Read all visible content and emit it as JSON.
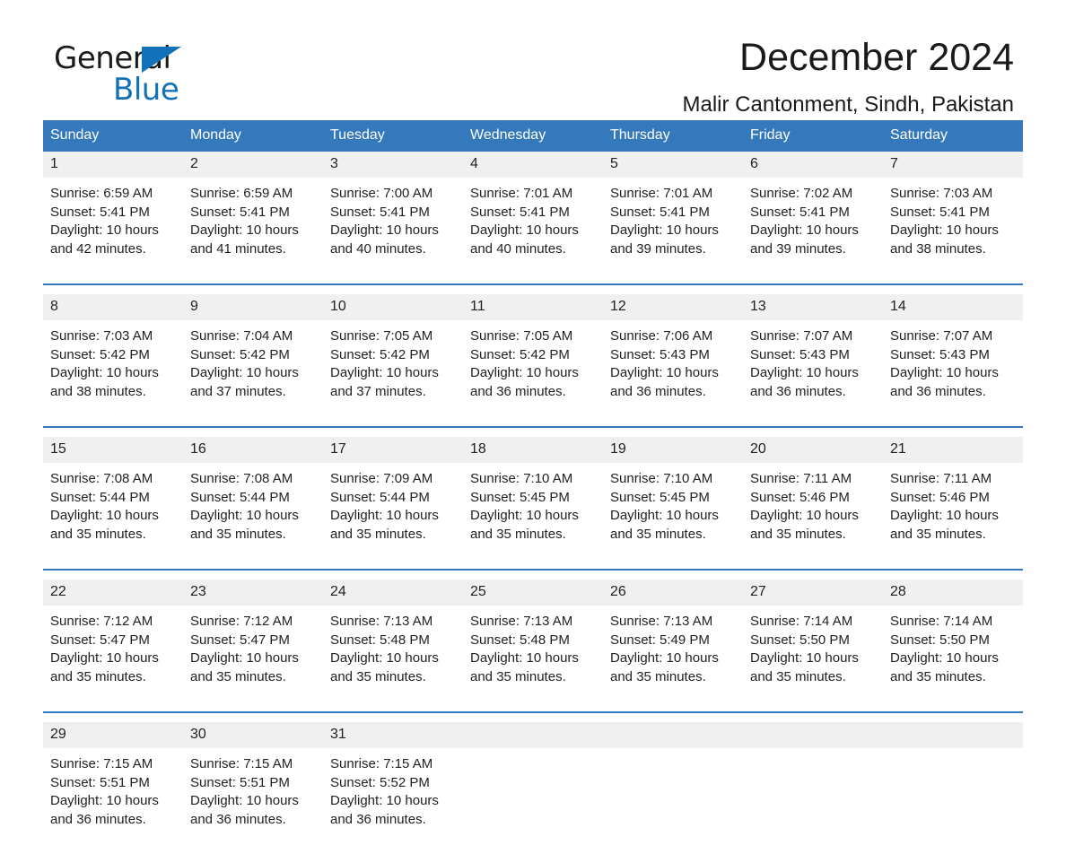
{
  "logo": {
    "word1": "General",
    "word2": "Blue",
    "triangle_color": "#1272b9"
  },
  "header": {
    "title": "December 2024",
    "subtitle": "Malir Cantonment, Sindh, Pakistan",
    "accent_color": "#3479bc",
    "daynum_bg": "#f0f0f0"
  },
  "calendar": {
    "weekday_headers": [
      "Sunday",
      "Monday",
      "Tuesday",
      "Wednesday",
      "Thursday",
      "Friday",
      "Saturday"
    ],
    "weeks": [
      [
        {
          "day": "1",
          "sunrise": "Sunrise: 6:59 AM",
          "sunset": "Sunset: 5:41 PM",
          "daylight1": "Daylight: 10 hours",
          "daylight2": "and 42 minutes."
        },
        {
          "day": "2",
          "sunrise": "Sunrise: 6:59 AM",
          "sunset": "Sunset: 5:41 PM",
          "daylight1": "Daylight: 10 hours",
          "daylight2": "and 41 minutes."
        },
        {
          "day": "3",
          "sunrise": "Sunrise: 7:00 AM",
          "sunset": "Sunset: 5:41 PM",
          "daylight1": "Daylight: 10 hours",
          "daylight2": "and 40 minutes."
        },
        {
          "day": "4",
          "sunrise": "Sunrise: 7:01 AM",
          "sunset": "Sunset: 5:41 PM",
          "daylight1": "Daylight: 10 hours",
          "daylight2": "and 40 minutes."
        },
        {
          "day": "5",
          "sunrise": "Sunrise: 7:01 AM",
          "sunset": "Sunset: 5:41 PM",
          "daylight1": "Daylight: 10 hours",
          "daylight2": "and 39 minutes."
        },
        {
          "day": "6",
          "sunrise": "Sunrise: 7:02 AM",
          "sunset": "Sunset: 5:41 PM",
          "daylight1": "Daylight: 10 hours",
          "daylight2": "and 39 minutes."
        },
        {
          "day": "7",
          "sunrise": "Sunrise: 7:03 AM",
          "sunset": "Sunset: 5:41 PM",
          "daylight1": "Daylight: 10 hours",
          "daylight2": "and 38 minutes."
        }
      ],
      [
        {
          "day": "8",
          "sunrise": "Sunrise: 7:03 AM",
          "sunset": "Sunset: 5:42 PM",
          "daylight1": "Daylight: 10 hours",
          "daylight2": "and 38 minutes."
        },
        {
          "day": "9",
          "sunrise": "Sunrise: 7:04 AM",
          "sunset": "Sunset: 5:42 PM",
          "daylight1": "Daylight: 10 hours",
          "daylight2": "and 37 minutes."
        },
        {
          "day": "10",
          "sunrise": "Sunrise: 7:05 AM",
          "sunset": "Sunset: 5:42 PM",
          "daylight1": "Daylight: 10 hours",
          "daylight2": "and 37 minutes."
        },
        {
          "day": "11",
          "sunrise": "Sunrise: 7:05 AM",
          "sunset": "Sunset: 5:42 PM",
          "daylight1": "Daylight: 10 hours",
          "daylight2": "and 36 minutes."
        },
        {
          "day": "12",
          "sunrise": "Sunrise: 7:06 AM",
          "sunset": "Sunset: 5:43 PM",
          "daylight1": "Daylight: 10 hours",
          "daylight2": "and 36 minutes."
        },
        {
          "day": "13",
          "sunrise": "Sunrise: 7:07 AM",
          "sunset": "Sunset: 5:43 PM",
          "daylight1": "Daylight: 10 hours",
          "daylight2": "and 36 minutes."
        },
        {
          "day": "14",
          "sunrise": "Sunrise: 7:07 AM",
          "sunset": "Sunset: 5:43 PM",
          "daylight1": "Daylight: 10 hours",
          "daylight2": "and 36 minutes."
        }
      ],
      [
        {
          "day": "15",
          "sunrise": "Sunrise: 7:08 AM",
          "sunset": "Sunset: 5:44 PM",
          "daylight1": "Daylight: 10 hours",
          "daylight2": "and 35 minutes."
        },
        {
          "day": "16",
          "sunrise": "Sunrise: 7:08 AM",
          "sunset": "Sunset: 5:44 PM",
          "daylight1": "Daylight: 10 hours",
          "daylight2": "and 35 minutes."
        },
        {
          "day": "17",
          "sunrise": "Sunrise: 7:09 AM",
          "sunset": "Sunset: 5:44 PM",
          "daylight1": "Daylight: 10 hours",
          "daylight2": "and 35 minutes."
        },
        {
          "day": "18",
          "sunrise": "Sunrise: 7:10 AM",
          "sunset": "Sunset: 5:45 PM",
          "daylight1": "Daylight: 10 hours",
          "daylight2": "and 35 minutes."
        },
        {
          "day": "19",
          "sunrise": "Sunrise: 7:10 AM",
          "sunset": "Sunset: 5:45 PM",
          "daylight1": "Daylight: 10 hours",
          "daylight2": "and 35 minutes."
        },
        {
          "day": "20",
          "sunrise": "Sunrise: 7:11 AM",
          "sunset": "Sunset: 5:46 PM",
          "daylight1": "Daylight: 10 hours",
          "daylight2": "and 35 minutes."
        },
        {
          "day": "21",
          "sunrise": "Sunrise: 7:11 AM",
          "sunset": "Sunset: 5:46 PM",
          "daylight1": "Daylight: 10 hours",
          "daylight2": "and 35 minutes."
        }
      ],
      [
        {
          "day": "22",
          "sunrise": "Sunrise: 7:12 AM",
          "sunset": "Sunset: 5:47 PM",
          "daylight1": "Daylight: 10 hours",
          "daylight2": "and 35 minutes."
        },
        {
          "day": "23",
          "sunrise": "Sunrise: 7:12 AM",
          "sunset": "Sunset: 5:47 PM",
          "daylight1": "Daylight: 10 hours",
          "daylight2": "and 35 minutes."
        },
        {
          "day": "24",
          "sunrise": "Sunrise: 7:13 AM",
          "sunset": "Sunset: 5:48 PM",
          "daylight1": "Daylight: 10 hours",
          "daylight2": "and 35 minutes."
        },
        {
          "day": "25",
          "sunrise": "Sunrise: 7:13 AM",
          "sunset": "Sunset: 5:48 PM",
          "daylight1": "Daylight: 10 hours",
          "daylight2": "and 35 minutes."
        },
        {
          "day": "26",
          "sunrise": "Sunrise: 7:13 AM",
          "sunset": "Sunset: 5:49 PM",
          "daylight1": "Daylight: 10 hours",
          "daylight2": "and 35 minutes."
        },
        {
          "day": "27",
          "sunrise": "Sunrise: 7:14 AM",
          "sunset": "Sunset: 5:50 PM",
          "daylight1": "Daylight: 10 hours",
          "daylight2": "and 35 minutes."
        },
        {
          "day": "28",
          "sunrise": "Sunrise: 7:14 AM",
          "sunset": "Sunset: 5:50 PM",
          "daylight1": "Daylight: 10 hours",
          "daylight2": "and 35 minutes."
        }
      ],
      [
        {
          "day": "29",
          "sunrise": "Sunrise: 7:15 AM",
          "sunset": "Sunset: 5:51 PM",
          "daylight1": "Daylight: 10 hours",
          "daylight2": "and 36 minutes."
        },
        {
          "day": "30",
          "sunrise": "Sunrise: 7:15 AM",
          "sunset": "Sunset: 5:51 PM",
          "daylight1": "Daylight: 10 hours",
          "daylight2": "and 36 minutes."
        },
        {
          "day": "31",
          "sunrise": "Sunrise: 7:15 AM",
          "sunset": "Sunset: 5:52 PM",
          "daylight1": "Daylight: 10 hours",
          "daylight2": "and 36 minutes."
        },
        {
          "day": "",
          "sunrise": "",
          "sunset": "",
          "daylight1": "",
          "daylight2": ""
        },
        {
          "day": "",
          "sunrise": "",
          "sunset": "",
          "daylight1": "",
          "daylight2": ""
        },
        {
          "day": "",
          "sunrise": "",
          "sunset": "",
          "daylight1": "",
          "daylight2": ""
        },
        {
          "day": "",
          "sunrise": "",
          "sunset": "",
          "daylight1": "",
          "daylight2": ""
        }
      ]
    ]
  }
}
